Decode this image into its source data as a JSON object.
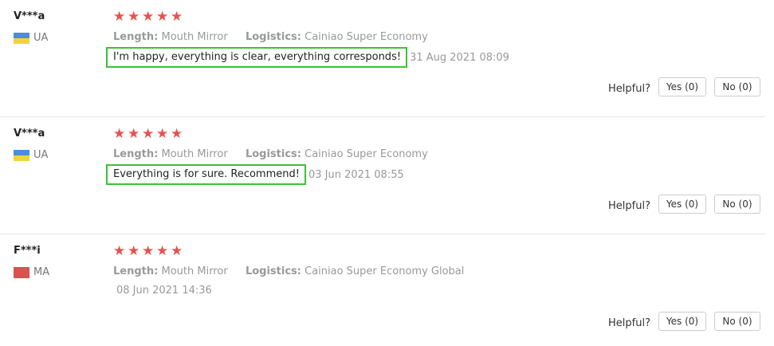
{
  "reviews": [
    {
      "user": "V***a",
      "country": "UA",
      "rating": 5,
      "length_label": "Length:",
      "length_value": "Mouth Mirror",
      "logistics_label": "Logistics:",
      "logistics_value": "Cainiao Super Economy",
      "text": "I'm happy, everything is clear, everything corresponds!",
      "date": "31 Aug 2021 08:09",
      "helpful_label": "Helpful?",
      "yes_label": "Yes (0)",
      "no_label": "No (0)"
    },
    {
      "user": "V***a",
      "country": "UA",
      "rating": 5,
      "length_label": "Length:",
      "length_value": "Mouth Mirror",
      "logistics_label": "Logistics:",
      "logistics_value": "Cainiao Super Economy",
      "text": "Everything is for sure. Recommend!",
      "date": "03 Jun 2021 08:55",
      "helpful_label": "Helpful?",
      "yes_label": "Yes (0)",
      "no_label": "No (0)"
    },
    {
      "user": "F***i",
      "country": "MA",
      "rating": 5,
      "length_label": "Length:",
      "length_value": "Mouth Mirror",
      "logistics_label": "Logistics:",
      "logistics_value": "Cainiao Super Economy Global",
      "text": "",
      "date": "08 Jun 2021 14:36",
      "helpful_label": "Helpful?",
      "yes_label": "Yes (0)",
      "no_label": "No (0)"
    }
  ],
  "colors": {
    "star": "#e8514f",
    "highlight_border": "#3ac23a",
    "flag_ua_top": "#4a90d9",
    "flag_ua_bottom": "#f2d43a",
    "flag_ma": "#d9534f"
  },
  "icons": {
    "star": "star-icon",
    "flag_ua": "ukraine-flag-icon",
    "flag_ma": "morocco-flag-icon"
  }
}
